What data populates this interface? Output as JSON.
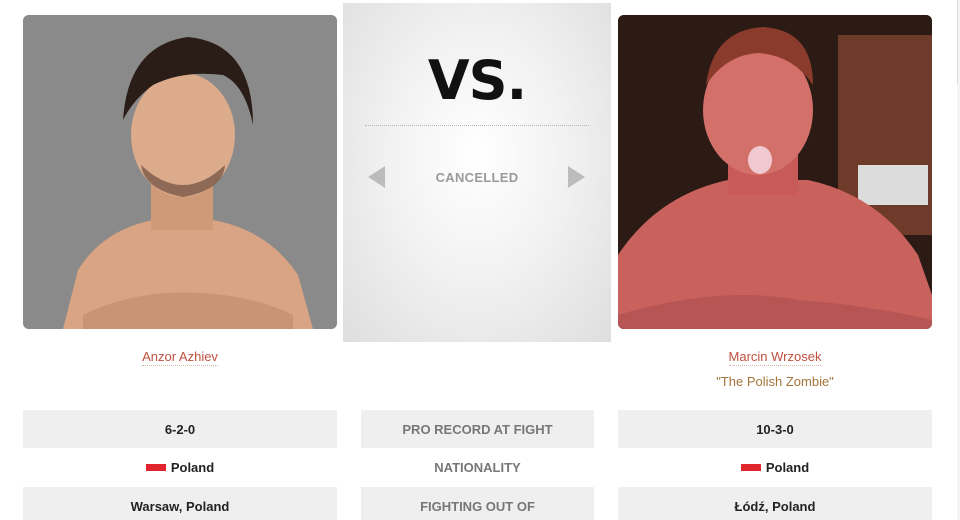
{
  "event": {
    "vs_label": "VS.",
    "status": "CANCELLED"
  },
  "fighters": {
    "left": {
      "name": "Anzor Azhiev",
      "record": "6-2-0",
      "nationality": "Poland",
      "fighting_out_of": "Warsaw, Poland"
    },
    "right": {
      "name": "Marcin Wrzosek",
      "nickname": "\"The Polish Zombie\"",
      "record": "10-3-0",
      "nationality": "Poland",
      "fighting_out_of": "Łódź, Poland"
    }
  },
  "labels": {
    "record": "PRO RECORD AT FIGHT",
    "nationality": "NATIONALITY",
    "fighting_out_of": "FIGHTING OUT OF"
  },
  "icons": {
    "prev": "arrow-left-icon",
    "next": "arrow-right-icon",
    "flag": "poland-flag-icon"
  },
  "colors": {
    "name_link": "#c0503f",
    "nickname": "#a5743a",
    "flag_red": "#e0252c"
  }
}
